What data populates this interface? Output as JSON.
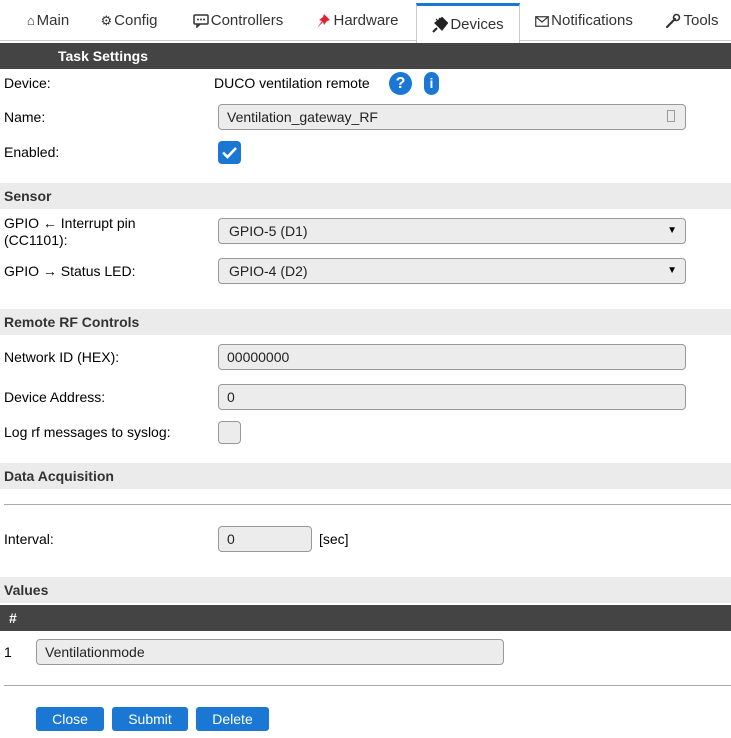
{
  "tabs": [
    {
      "label": "Main",
      "icon": "home-icon",
      "active": false
    },
    {
      "label": "Config",
      "icon": "gear-icon",
      "active": false
    },
    {
      "label": "Controllers",
      "icon": "chat-icon",
      "active": false
    },
    {
      "label": "Hardware",
      "icon": "pin-icon",
      "active": false
    },
    {
      "label": "Devices",
      "icon": "plug-icon",
      "active": true
    },
    {
      "label": "Notifications",
      "icon": "mail-icon",
      "active": false
    },
    {
      "label": "Tools",
      "icon": "wrench-icon",
      "active": false
    }
  ],
  "task": {
    "header": "Task Settings",
    "device_label": "Device:",
    "device_value": "DUCO ventilation remote",
    "help_glyph": "?",
    "info_glyph": "i",
    "name_label": "Name:",
    "name_value": "Ventilation_gateway_RF",
    "enabled_label": "Enabled:",
    "enabled": true
  },
  "sensor": {
    "header": "Sensor",
    "gpio_irq_label_1": "GPIO ← Interrupt pin",
    "gpio_irq_label_2": "(CC1101):",
    "gpio_irq_value": "GPIO-5 (D1)",
    "gpio_led_label": "GPIO → Status LED:",
    "gpio_led_value": "GPIO-4 (D2)"
  },
  "rf": {
    "header": "Remote RF Controls",
    "network_label": "Network ID (HEX):",
    "network_value": "00000000",
    "address_label": "Device Address:",
    "address_value": "0",
    "log_label": "Log rf messages to syslog:",
    "log_enabled": false
  },
  "acq": {
    "header": "Data Acquisition",
    "interval_label": "Interval:",
    "interval_value": "0",
    "interval_unit": "[sec]"
  },
  "values": {
    "header": "Values",
    "col_hash": "#",
    "rows": [
      {
        "index": "1",
        "name": "Ventilationmode"
      }
    ]
  },
  "buttons": {
    "close": "Close",
    "submit": "Submit",
    "delete": "Delete"
  },
  "colors": {
    "accent": "#1a78d4",
    "header_dark": "#444444",
    "header_gray": "#ebebeb"
  }
}
